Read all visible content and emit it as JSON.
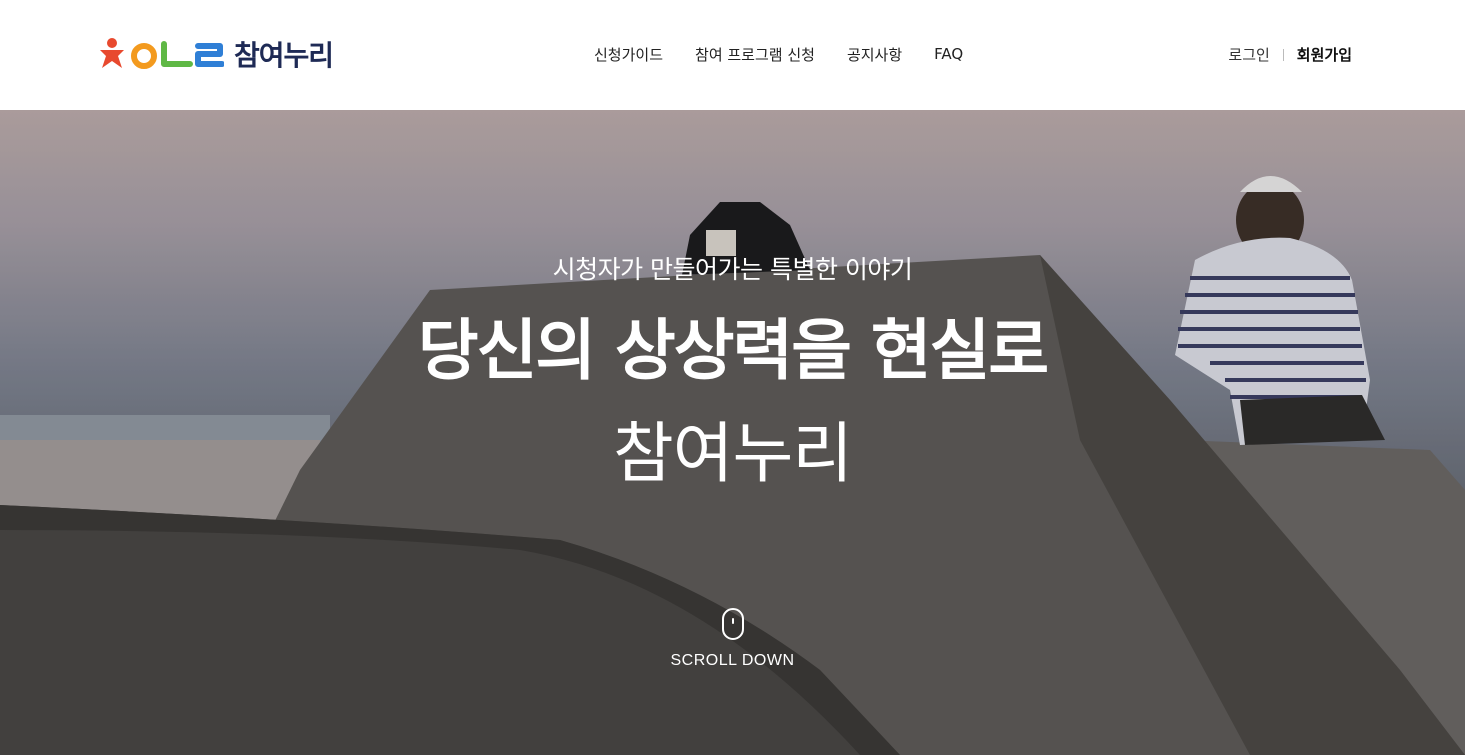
{
  "header": {
    "logo_text": "참여누리",
    "nav": [
      {
        "label": "신청가이드"
      },
      {
        "label": "참여 프로그램 신청"
      },
      {
        "label": "공지사항"
      },
      {
        "label": "FAQ"
      }
    ],
    "login_label": "로그인",
    "join_label": "회원가입"
  },
  "hero": {
    "subtitle": "시청자가 만들어가는 특별한 이야기",
    "title": "당신의 상상력을 현실로",
    "brand": "참여누리",
    "scroll_label": "SCROLL DOWN"
  },
  "colors": {
    "logo_star": "#e8492e",
    "logo_o": "#f39a1e",
    "logo_l": "#5fb845",
    "logo_e": "#2f7fd6",
    "logo_text": "#1e2a55",
    "hero_text": "#ffffff"
  },
  "icons": {
    "logo": "olleh-logo-icon",
    "scroll": "mouse-icon"
  }
}
